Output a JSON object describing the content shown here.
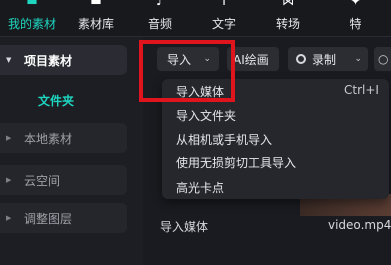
{
  "topnav": {
    "items": [
      {
        "label": "我的素材",
        "icon": "folder-icon",
        "active": true
      },
      {
        "label": "素材库",
        "icon": "box-icon",
        "active": false
      },
      {
        "label": "音频",
        "icon": "music-icon",
        "active": false
      },
      {
        "label": "文字",
        "icon": "text-icon",
        "active": false
      },
      {
        "label": "转场",
        "icon": "transition-icon",
        "active": false
      },
      {
        "label": "特",
        "icon": "effects-icon",
        "active": false
      }
    ]
  },
  "sidebar": {
    "section_title": "项目素材",
    "subitem": "文件夹",
    "items": [
      {
        "label": "本地素材"
      },
      {
        "label": "云空间"
      },
      {
        "label": "调整图层"
      }
    ]
  },
  "toolbar": {
    "import_label": "导入",
    "ai_label": "AI绘画",
    "record_label": "录制"
  },
  "import_menu": {
    "items": [
      {
        "label": "导入媒体",
        "shortcut": "Ctrl+I"
      },
      {
        "label": "导入文件夹",
        "shortcut": ""
      },
      {
        "label": "从相机或手机导入",
        "shortcut": ""
      },
      {
        "label": "使用无损剪切工具导入",
        "shortcut": ""
      },
      {
        "label": "高光卡点",
        "shortcut": ""
      }
    ]
  },
  "media": {
    "import_placeholder_label": "导入媒体",
    "clip_name": "video.mp4"
  },
  "colors": {
    "accent": "#1ed6c0",
    "highlight": "#e0141c",
    "background": "#1a1b20"
  }
}
